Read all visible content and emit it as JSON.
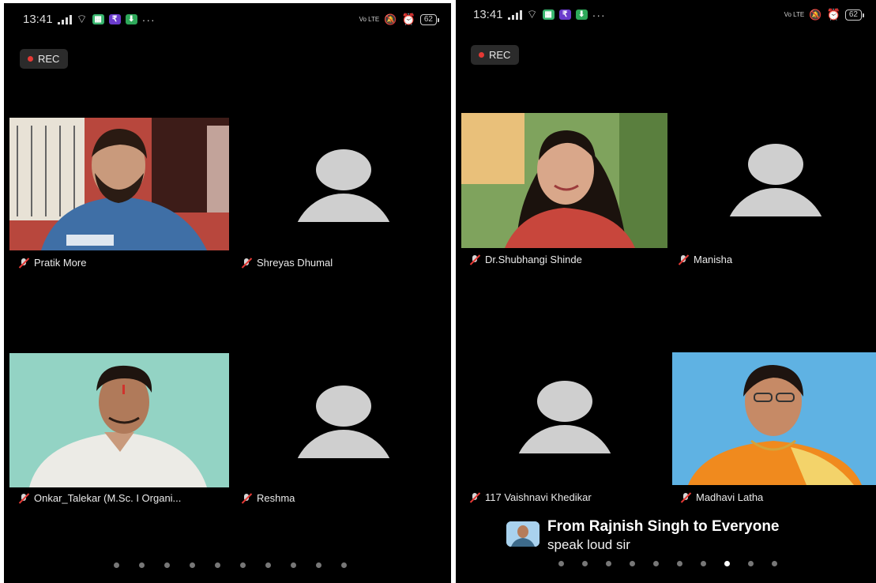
{
  "left": {
    "status": {
      "time": "13:41",
      "volte": "Vo LTE",
      "battery": "62"
    },
    "rec_label": "REC",
    "tiles": [
      {
        "name": "Pratik More",
        "type": "video"
      },
      {
        "name": "Shreyas Dhumal",
        "type": "avatar"
      },
      {
        "name": "Onkar_Talekar (M.Sc. I Organi...",
        "type": "video"
      },
      {
        "name": "Reshma",
        "type": "avatar"
      }
    ],
    "pager": {
      "count": 10,
      "active": -1
    }
  },
  "right": {
    "status": {
      "time": "13:41",
      "volte": "Vo LTE",
      "battery": "62"
    },
    "rec_label": "REC",
    "tiles": [
      {
        "name": "Dr.Shubhangi Shinde",
        "type": "video"
      },
      {
        "name": "Manisha",
        "type": "avatar"
      },
      {
        "name": "117 Vaishnavi Khedikar",
        "type": "avatar"
      },
      {
        "name": "Madhavi Latha",
        "type": "video"
      }
    ],
    "chat": {
      "from": "From Rajnish Singh to Everyone",
      "message": "speak loud sir"
    },
    "pager": {
      "count": 10,
      "active": 7
    }
  },
  "colors": {
    "background": "#000000",
    "rec_dot": "#e53935",
    "avatar_gray": "#cfcfcf",
    "muted_slash": "#e53935"
  }
}
